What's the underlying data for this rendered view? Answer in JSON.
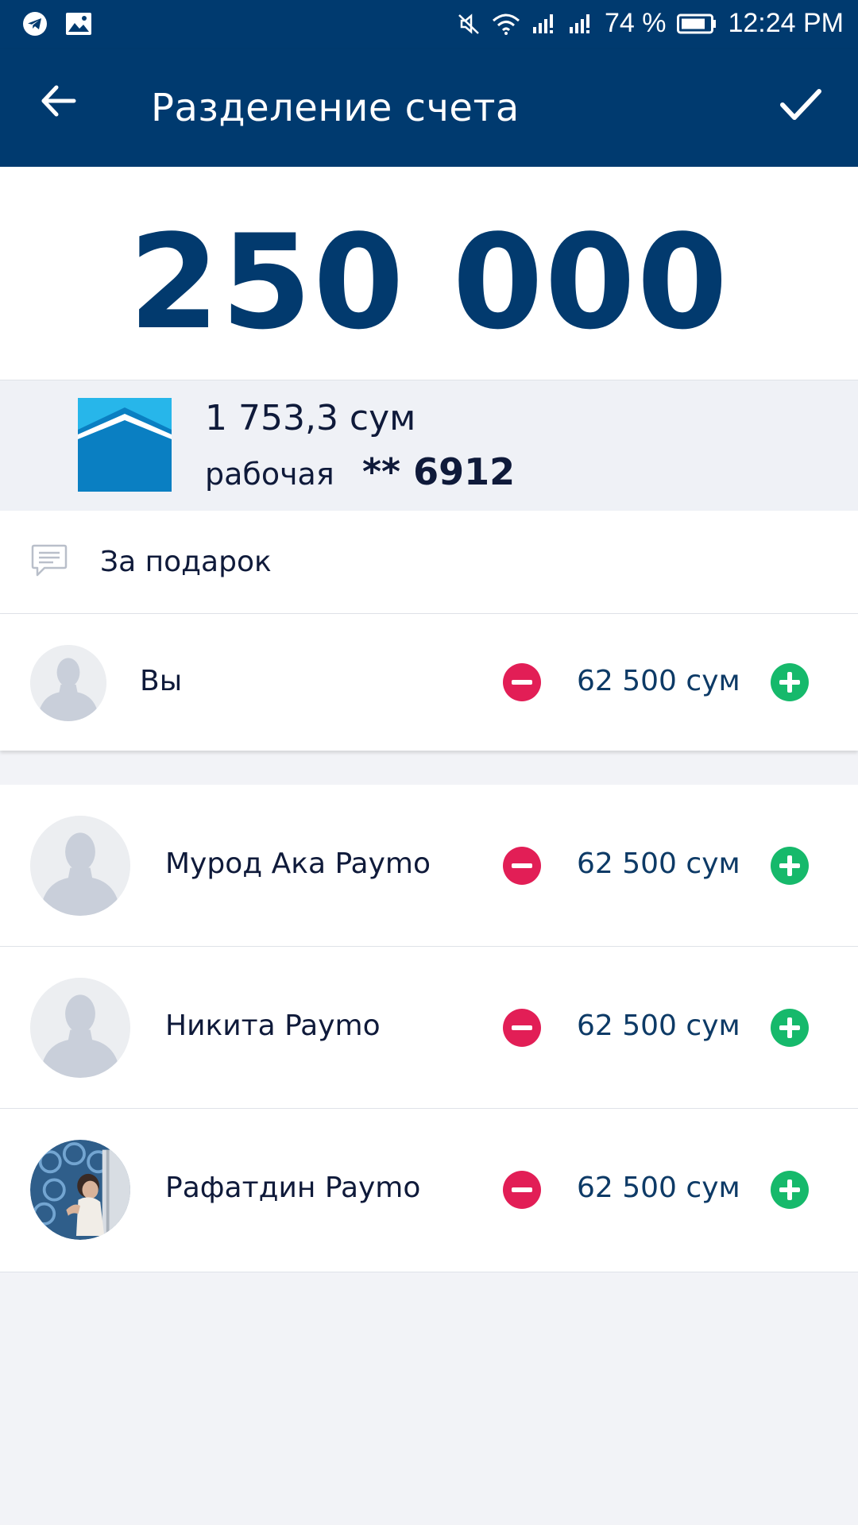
{
  "status_bar": {
    "left_icons": [
      "telegram-icon",
      "image-icon"
    ],
    "right_icons": [
      "mute-icon",
      "wifi-icon",
      "signal-icon",
      "signal-icon"
    ],
    "battery_percent": "74 %",
    "time": "12:24 PM"
  },
  "app_bar": {
    "title": "Разделение счета",
    "back_icon": "arrow-back-icon",
    "confirm_icon": "check-icon"
  },
  "colors": {
    "primary": "#003a6f",
    "amount": "#023a6e",
    "minus": "#e21e56",
    "plus": "#16b96b"
  },
  "total": {
    "amount": "250 000"
  },
  "card": {
    "balance": "1 753,3 сум",
    "name": "рабочая",
    "number": "** 6912"
  },
  "comment": {
    "icon": "comment-icon",
    "text": "За подарок"
  },
  "participants": [
    {
      "name": "Вы",
      "amount": "62 500 сум",
      "avatar": "default"
    },
    {
      "name": "Мурод Ака Paymo",
      "amount": "62 500 сум",
      "avatar": "default"
    },
    {
      "name": "Никита Paymo",
      "amount": "62 500 сум",
      "avatar": "default"
    },
    {
      "name": "Рафатдин Paymo",
      "amount": "62 500 сум",
      "avatar": "photo"
    }
  ]
}
